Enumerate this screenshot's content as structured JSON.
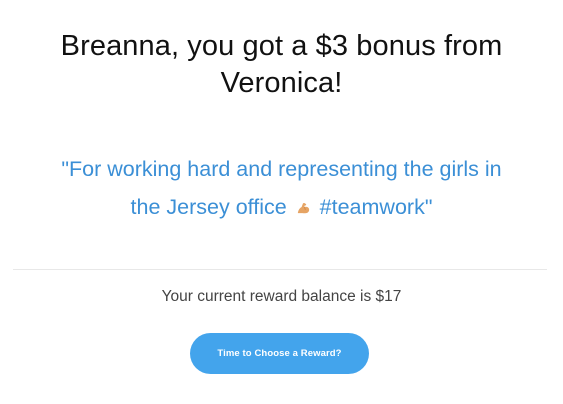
{
  "headline": {
    "line1": "Breanna, you got a $3 bonus from",
    "line2": "Veronica!"
  },
  "message": {
    "line1": "\"For working hard and representing the girls in",
    "line2_prefix": "the Jersey office",
    "emoji": "flexed-biceps-icon",
    "line2_suffix": "#teamwork\""
  },
  "balance_text": "Your current reward balance is $17",
  "cta_label": "Time to Choose a Reward?",
  "colors": {
    "quote": "#3b8fd6",
    "button": "#43a4ec",
    "divider": "#e8e8e8"
  }
}
